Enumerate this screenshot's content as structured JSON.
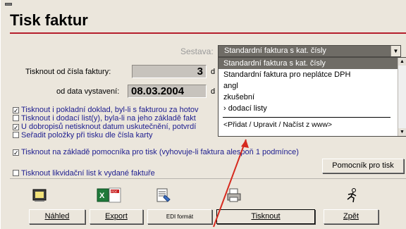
{
  "window": {
    "title": "Tisk faktur"
  },
  "sestava": {
    "label": "Sestava:",
    "selected": "Standardní faktura s kat. čísly",
    "options": [
      "Standardní faktura s kat. čísly",
      "Standardní faktura pro neplátce DPH",
      "angl",
      "zkušební",
      "› dodací listy"
    ],
    "footer_option": "<Přidat / Upravit / Načíst z www>"
  },
  "form": {
    "invoice_from_label": "Tisknout od čísla faktury:",
    "invoice_from_value": "3",
    "invoice_from_suffix": "d",
    "date_label": "od data vystavení:",
    "date_value": "08.03.2004",
    "date_suffix": "d"
  },
  "checkboxes": [
    {
      "text": "Tisknout i pokladní doklad, byl-li s fakturou za hotov",
      "checked": true
    },
    {
      "text": "Tisknout i dodací list(y), byla-li na jeho základě fakt",
      "checked": false
    },
    {
      "text": "U dobropisů netisknout datum uskutečnění, potvrdí",
      "checked": true
    },
    {
      "text": "Seřadit položky při tisku dle čísla karty",
      "checked": false
    },
    {
      "text": "Tisknout na základě pomocníka pro tisk (vyhovuje-li faktura alespoň 1 podmínce)",
      "checked": true
    },
    {
      "text": "Tisknout likvidační list k vydané faktuře",
      "checked": false
    }
  ],
  "buttons": {
    "helper": "Pomocník pro tisk",
    "preview": "Náhled",
    "export": "Export",
    "edi": "EDI formát",
    "print": "Tisknout",
    "back": "Zpět"
  },
  "colors": {
    "accent_rule": "#b51e2d",
    "annotation_arrow": "#d62a1e",
    "checkbox_text": "#1d1d8f"
  }
}
